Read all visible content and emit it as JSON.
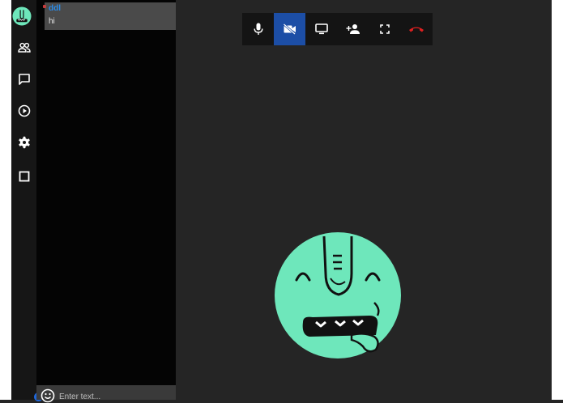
{
  "sidebar": {
    "unread_count": "1",
    "items": [
      {
        "name": "participants",
        "icon": "people-icon"
      },
      {
        "name": "chat",
        "icon": "chat-icon"
      },
      {
        "name": "shared-video",
        "icon": "play-circle-icon"
      },
      {
        "name": "settings",
        "icon": "gear-icon"
      },
      {
        "name": "tile-view",
        "icon": "square-icon"
      }
    ]
  },
  "chat": {
    "messages": [
      {
        "author": "ddl",
        "text": "hi"
      }
    ],
    "input": {
      "placeholder": "Enter text...",
      "value": ""
    }
  },
  "toolbar": {
    "buttons": [
      {
        "name": "microphone",
        "icon": "microphone-icon",
        "active": false
      },
      {
        "name": "camera",
        "icon": "camera-off-icon",
        "active": true
      },
      {
        "name": "screen-share",
        "icon": "monitor-icon",
        "active": false
      },
      {
        "name": "invite",
        "icon": "add-person-icon",
        "active": false
      },
      {
        "name": "fullscreen",
        "icon": "fullscreen-icon",
        "active": false
      },
      {
        "name": "hangup",
        "icon": "phone-hangup-icon",
        "active": false
      }
    ]
  },
  "colors": {
    "background": "#252525",
    "accent": "#1c4ea6",
    "author": "#2b8be6",
    "hangup": "#e02020",
    "avatar": "#6ee7bb"
  }
}
